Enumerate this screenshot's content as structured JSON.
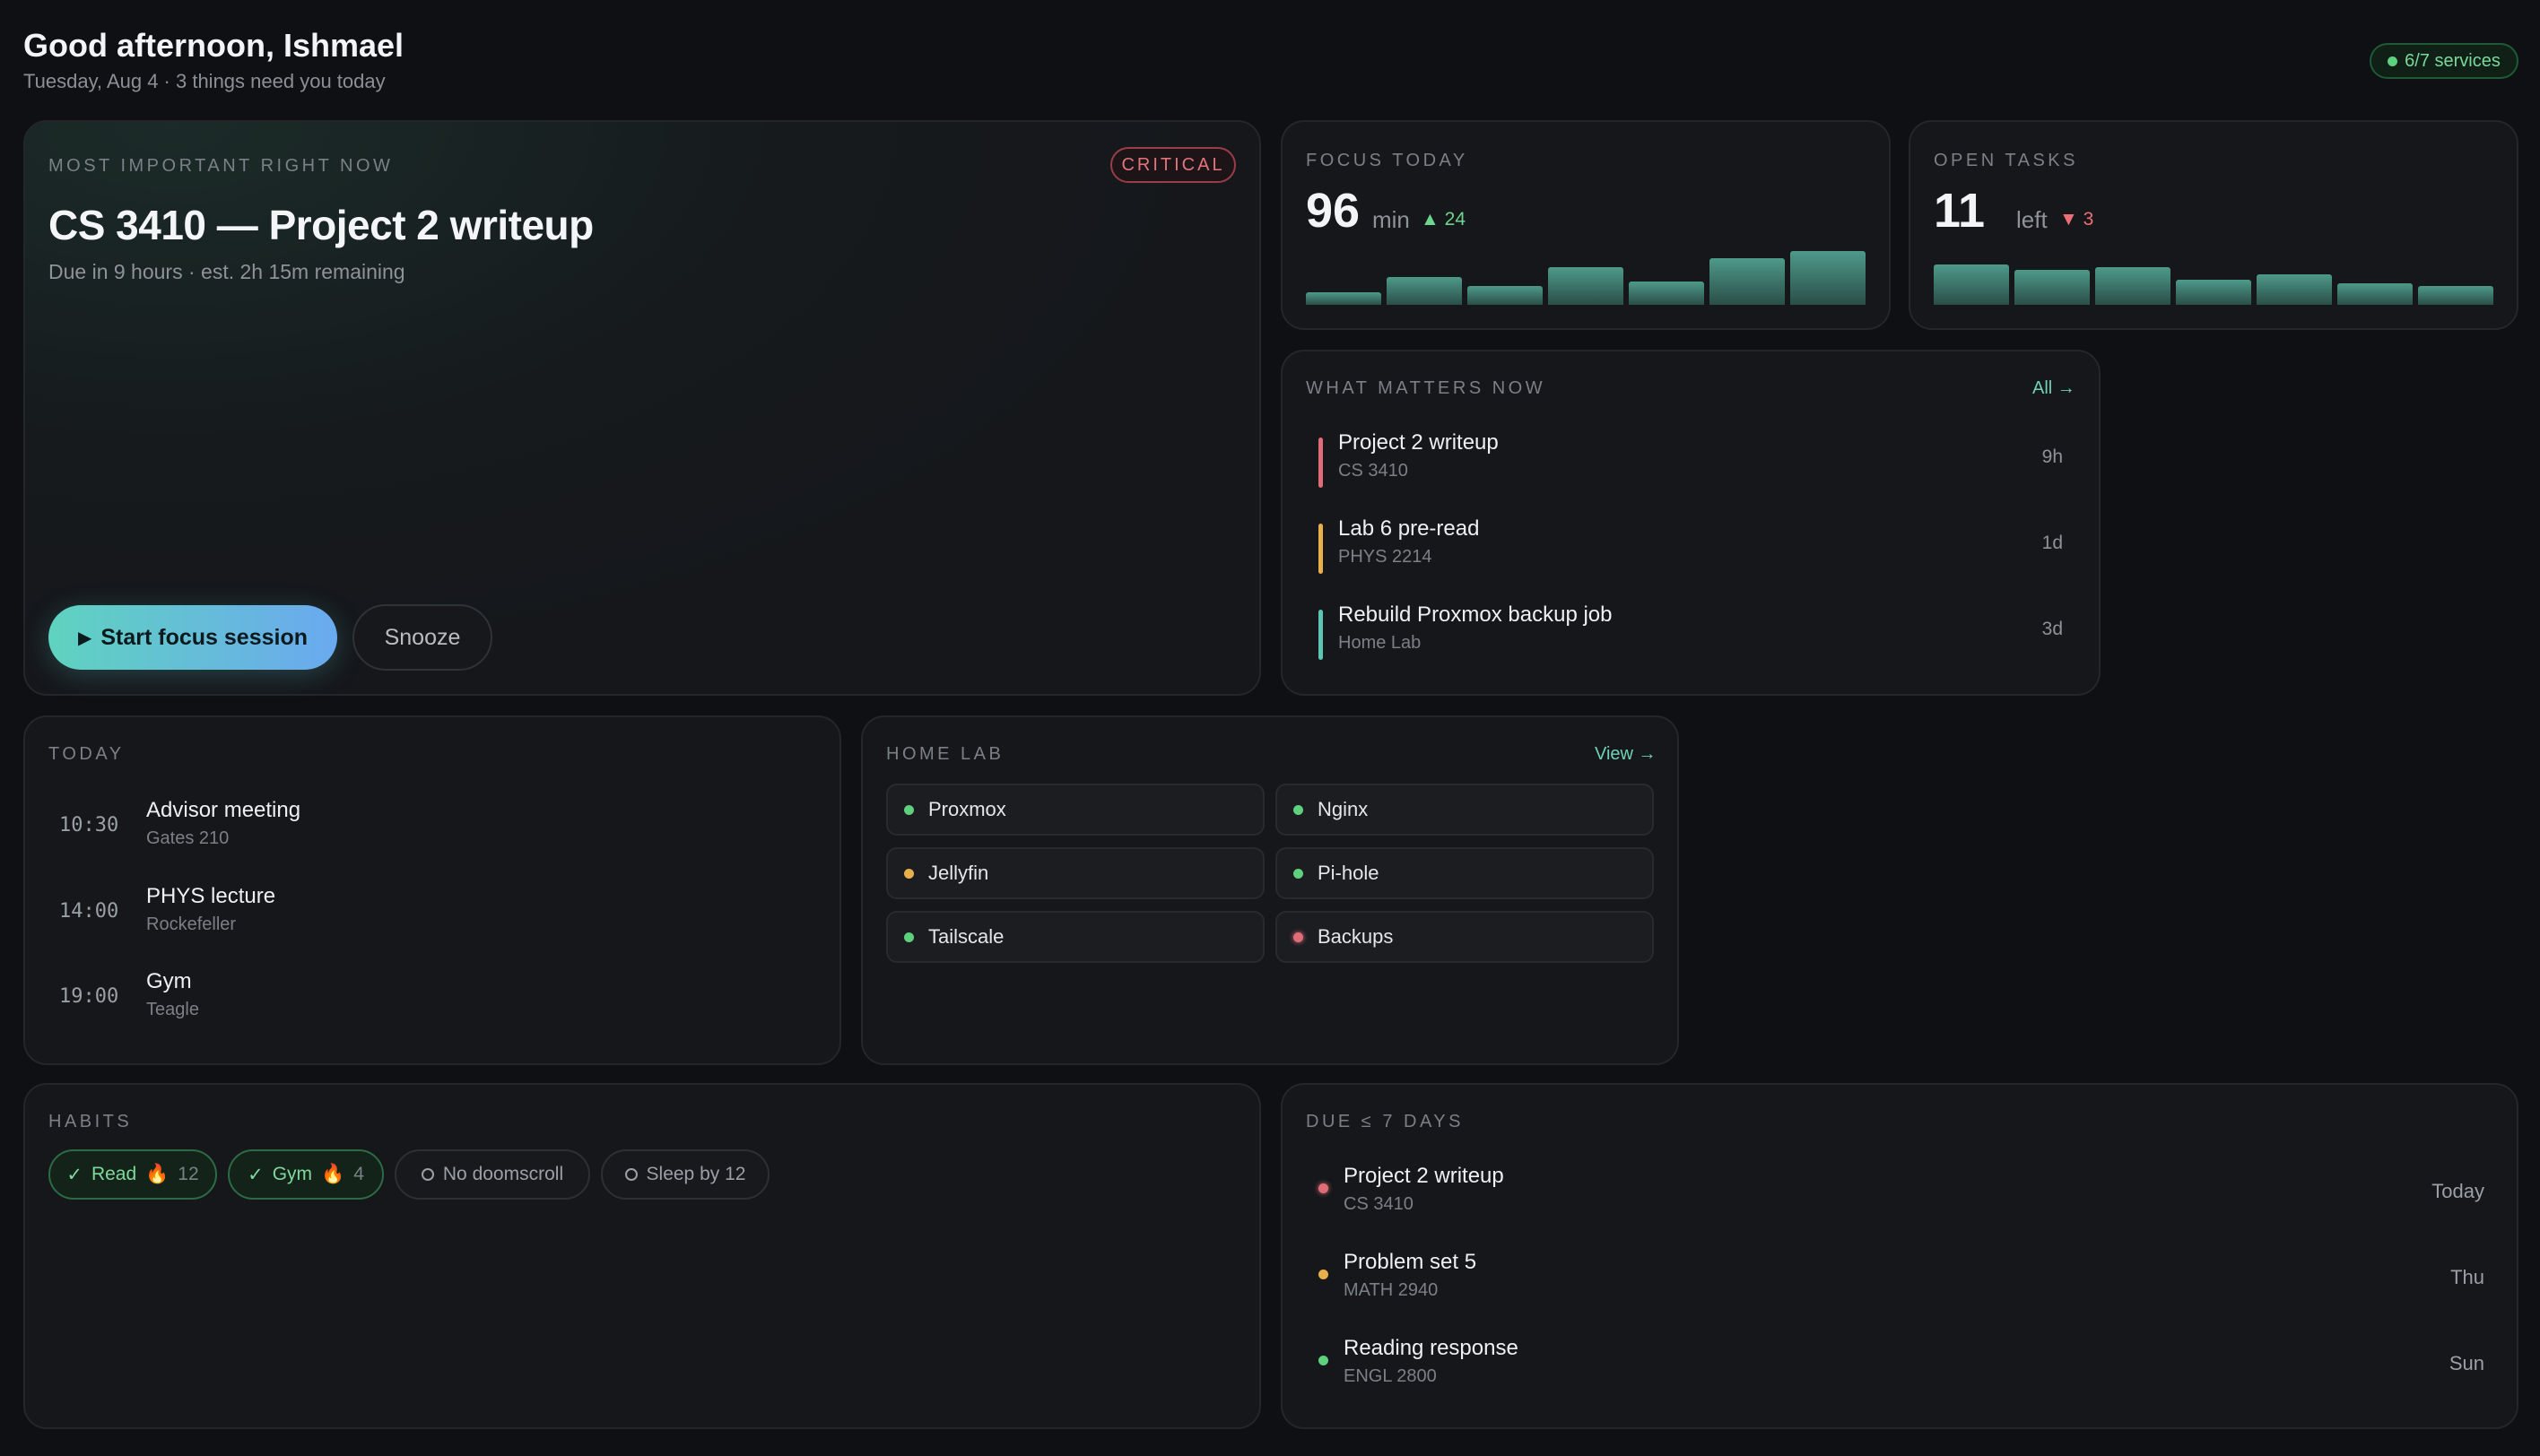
{
  "header": {
    "greeting": "Good afternoon, Ishmael",
    "subline": "Tuesday, Aug 4 · 3 things need you today",
    "services_badge": "6/7 services"
  },
  "hero": {
    "label": "MOST IMPORTANT RIGHT NOW",
    "badge": "CRITICAL",
    "title": "CS 3410 — Project 2 writeup",
    "subtitle": "Due in 9 hours · est. 2h 15m remaining",
    "start_label": "Start focus session",
    "snooze_label": "Snooze"
  },
  "focus": {
    "label": "FOCUS TODAY",
    "value": "96",
    "unit": "min",
    "delta": "24",
    "bars": [
      0.15,
      0.33,
      0.22,
      0.45,
      0.28,
      0.55,
      0.64
    ]
  },
  "tasks": {
    "label": "OPEN TASKS",
    "value": "11",
    "unit": "left",
    "delta": "3",
    "bars": [
      0.48,
      0.42,
      0.45,
      0.3,
      0.36,
      0.26,
      0.22
    ]
  },
  "what_matters": {
    "label": "WHAT MATTERS NOW",
    "link": "All →",
    "items": [
      {
        "title": "Project 2 writeup",
        "sub": "CS 3410",
        "time": "9h",
        "color": "#e06c78"
      },
      {
        "title": "Lab 6 pre-read",
        "sub": "PHYS 2214",
        "time": "1d",
        "color": "#e8b04a"
      },
      {
        "title": "Rebuild Proxmox backup job",
        "sub": "Home Lab",
        "time": "3d",
        "color": "#5cc6b2"
      }
    ]
  },
  "today": {
    "label": "TODAY",
    "events": [
      {
        "time": "10:30",
        "title": "Advisor meeting",
        "place": "Gates 210"
      },
      {
        "time": "14:00",
        "title": "PHYS lecture",
        "place": "Rockefeller"
      },
      {
        "time": "19:00",
        "title": "Gym",
        "place": "Teagle"
      }
    ]
  },
  "homelab": {
    "label": "HOME LAB",
    "link": "View →",
    "services": [
      {
        "name": "Proxmox",
        "status_color": "#5fd17e"
      },
      {
        "name": "Nginx",
        "status_color": "#5fd17e"
      },
      {
        "name": "Jellyfin",
        "status_color": "#e8b04a"
      },
      {
        "name": "Pi-hole",
        "status_color": "#5fd17e"
      },
      {
        "name": "Tailscale",
        "status_color": "#5fd17e"
      },
      {
        "name": "Backups",
        "status_color": "#e06c78"
      }
    ]
  },
  "habits": {
    "label": "HABITS",
    "items": [
      {
        "name": "Read",
        "done": true,
        "streak": "12"
      },
      {
        "name": "Gym",
        "done": true,
        "streak": "4"
      },
      {
        "name": "No doomscroll",
        "done": false
      },
      {
        "name": "Sleep by 12",
        "done": false
      }
    ]
  },
  "due": {
    "label": "DUE ≤ 7 DAYS",
    "items": [
      {
        "title": "Project 2 writeup",
        "course": "CS 3410",
        "when": "Today",
        "color": "#e06c78"
      },
      {
        "title": "Problem set 5",
        "course": "MATH 2940",
        "when": "Thu",
        "color": "#e8b04a"
      },
      {
        "title": "Reading response",
        "course": "ENGL 2800",
        "when": "Sun",
        "color": "#5fd17e"
      }
    ]
  }
}
